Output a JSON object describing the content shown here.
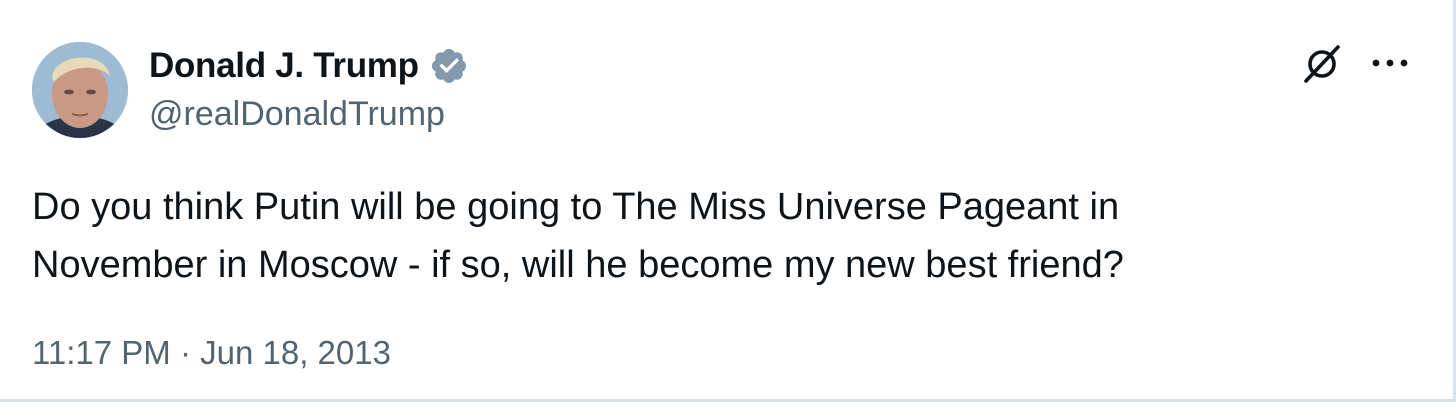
{
  "author": {
    "display_name": "Donald J. Trump",
    "handle": "@realDonaldTrump",
    "verified": true,
    "avatar": "profile-photo"
  },
  "tweet": {
    "text": "Do you think Putin will be going to The Miss Universe Pageant in\nNovember in Moscow - if so, will he become my new best friend?",
    "time": "11:17 PM",
    "separator": " · ",
    "date": "Jun 18, 2013"
  },
  "icons": {
    "verified": "verified-badge-icon",
    "grok": "grok-slash-icon",
    "more": "more-dots-icon"
  },
  "colors": {
    "verified_badge": "#829aab",
    "secondary_text": "#536471",
    "primary_text": "#0f1419",
    "border": "#d6e4ea"
  }
}
